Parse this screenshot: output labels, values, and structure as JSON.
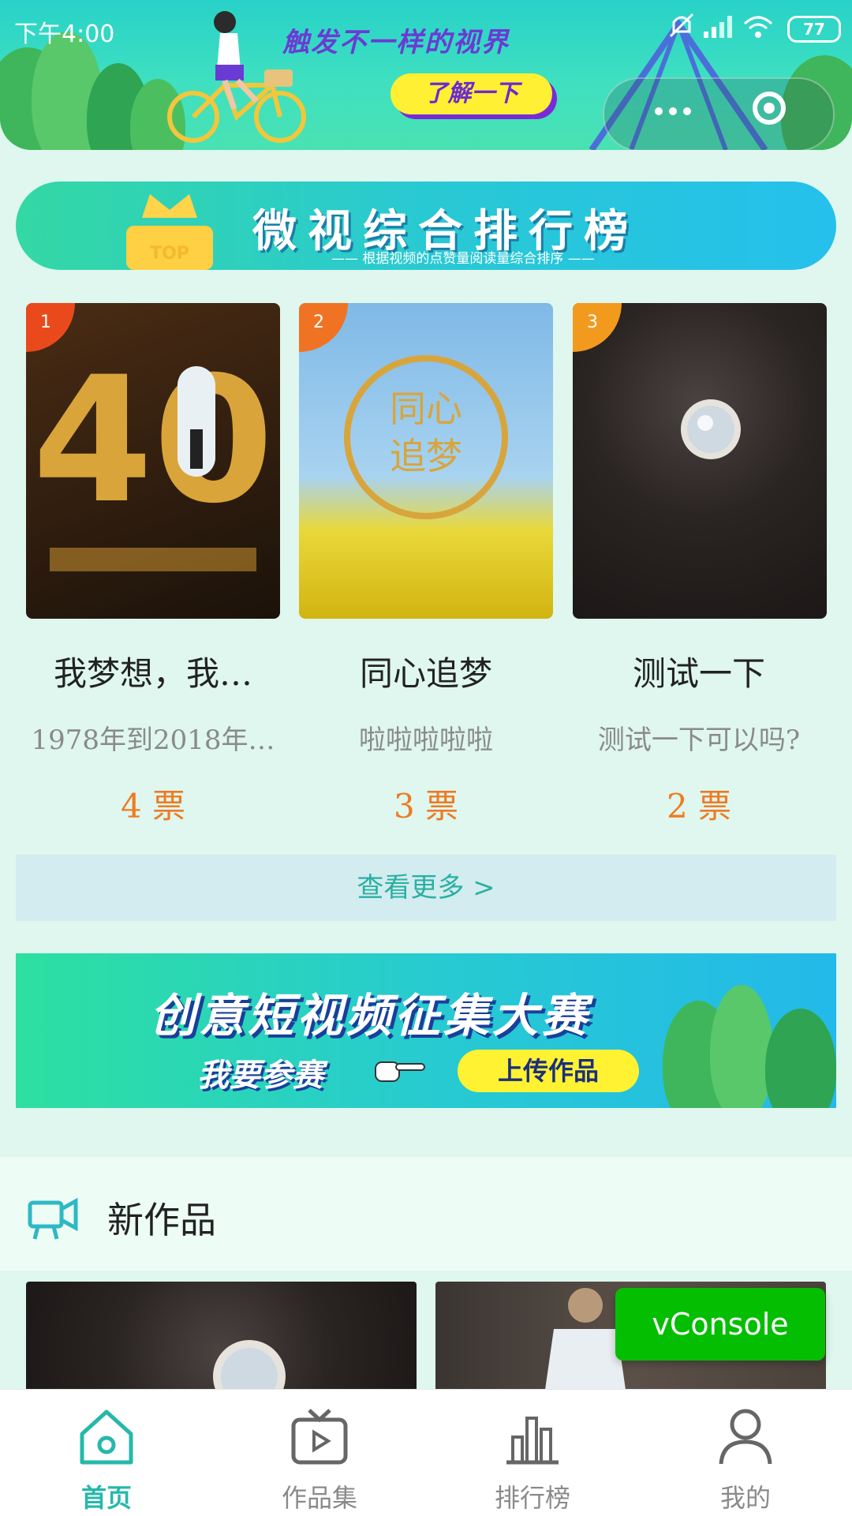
{
  "status_bar": {
    "time": "下午4:00",
    "battery": "77"
  },
  "top_banner": {
    "slogan": "触发不一样的视界",
    "button_label": "了解一下"
  },
  "rank_banner": {
    "title": "微视综合排行榜",
    "subtitle": "—— 根据视频的点赞量阅读量综合排序 ——",
    "crown_text": "TOP"
  },
  "top_works": [
    {
      "rank": "1",
      "title": "我梦想，我…",
      "desc": "1978年到2018年…",
      "votes": "4 票",
      "thumb_text": "40",
      "badge_color": "#ea4a1b"
    },
    {
      "rank": "2",
      "title": "同心追梦",
      "desc": "啦啦啦啦啦",
      "votes": "3 票",
      "thumb_text": "同心追梦",
      "badge_color": "#f07324"
    },
    {
      "rank": "3",
      "title": "测试一下",
      "desc": "测试一下可以吗?",
      "votes": "2 票",
      "thumb_text": "",
      "badge_color": "#f29a1e"
    }
  ],
  "view_more_label": "查看更多 >",
  "contest_banner": {
    "title": "创意短视频征集大赛",
    "join_text": "我要参赛",
    "upload_label": "上传作品"
  },
  "new_works": {
    "title": "新作品"
  },
  "vconsole_label": "vConsole",
  "tab_bar": [
    {
      "label": "首页",
      "icon": "home-icon",
      "active": true
    },
    {
      "label": "作品集",
      "icon": "play-icon",
      "active": false
    },
    {
      "label": "排行榜",
      "icon": "chart-icon",
      "active": false
    },
    {
      "label": "我的",
      "icon": "user-icon",
      "active": false
    }
  ],
  "colors": {
    "accent": "#26b8aa",
    "votes": "#ee7b22",
    "vconsole": "#04be02"
  }
}
